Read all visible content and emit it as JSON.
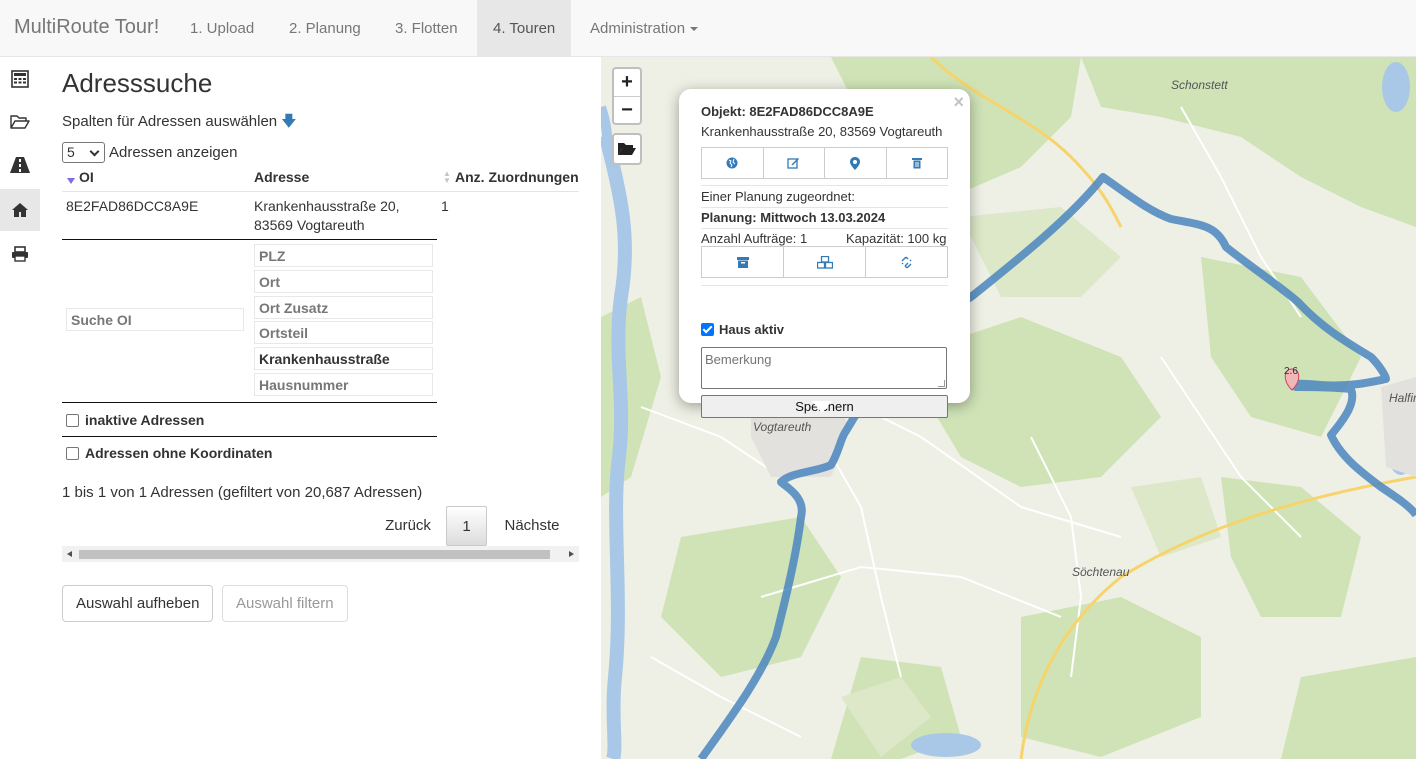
{
  "navbar": {
    "brand": "MultiRoute Tour!",
    "items": [
      {
        "label": "1. Upload"
      },
      {
        "label": "2. Planung"
      },
      {
        "label": "3. Flotten"
      },
      {
        "label": "4. Touren",
        "active": true
      },
      {
        "label": "Administration"
      }
    ]
  },
  "sidebar": {
    "icons": [
      "calculator-icon",
      "folder-open-icon",
      "road-icon",
      "home-icon",
      "print-icon"
    ],
    "active": "home-icon"
  },
  "panel": {
    "title": "Adresssuche",
    "column_select": "Spalten für Adressen auswählen",
    "length": {
      "selected": "5",
      "label": "Adressen anzeigen"
    },
    "table": {
      "headers": [
        "OI",
        "Adresse",
        "Anz. Zuordnungen"
      ],
      "rows": [
        {
          "oi": "8E2FAD86DCC8A9E",
          "address_line1": "Krankenhausstraße 20,",
          "address_line2": "83569 Vogtareuth",
          "count": "1"
        }
      ]
    },
    "filters": {
      "oi_placeholder": "Suche OI",
      "plz": "PLZ",
      "ort": "Ort",
      "ort_zusatz": "Ort Zusatz",
      "ortsteil": "Ortsteil",
      "strasse": "Krankenhausstraße",
      "hausnummer": "Hausnummer"
    },
    "checkbox_inactive": "inaktive Adressen",
    "checkbox_nocoords": "Adressen ohne Koordinaten",
    "info": "1 bis 1 von 1 Adressen (gefiltert von 20,687 Adressen)",
    "pagination": {
      "prev": "Zurück",
      "current": "1",
      "next": "Nächste"
    },
    "btn_clear": "Auswahl aufheben",
    "btn_filter": "Auswahl filtern"
  },
  "map": {
    "zoom_in": "+",
    "zoom_out": "−",
    "places": [
      "Schonstett",
      "Vogtareuth",
      "Halfing",
      "Söchtenau"
    ],
    "marker_label": "2.6",
    "route_color": "#4a86c0",
    "popup": {
      "object_line": "Objekt: 8E2FAD86DCC8A9E",
      "address": "Krankenhausstraße 20, 83569 Vogtareuth",
      "actions1": [
        "globe-icon",
        "edit-icon",
        "map-marker-icon",
        "trash-icon"
      ],
      "assigned_label": "Einer Planung zugeordnet:",
      "planning": "Planung: Mittwoch 13.03.2024",
      "orders": "Anzahl Aufträge: 1",
      "capacity": "Kapazität: 100 kg",
      "actions2": [
        "archive-icon",
        "boxes-icon",
        "unlink-icon"
      ],
      "house_active": "Haus aktiv",
      "remark_placeholder": "Bemerkung",
      "save": "Speichern"
    }
  }
}
